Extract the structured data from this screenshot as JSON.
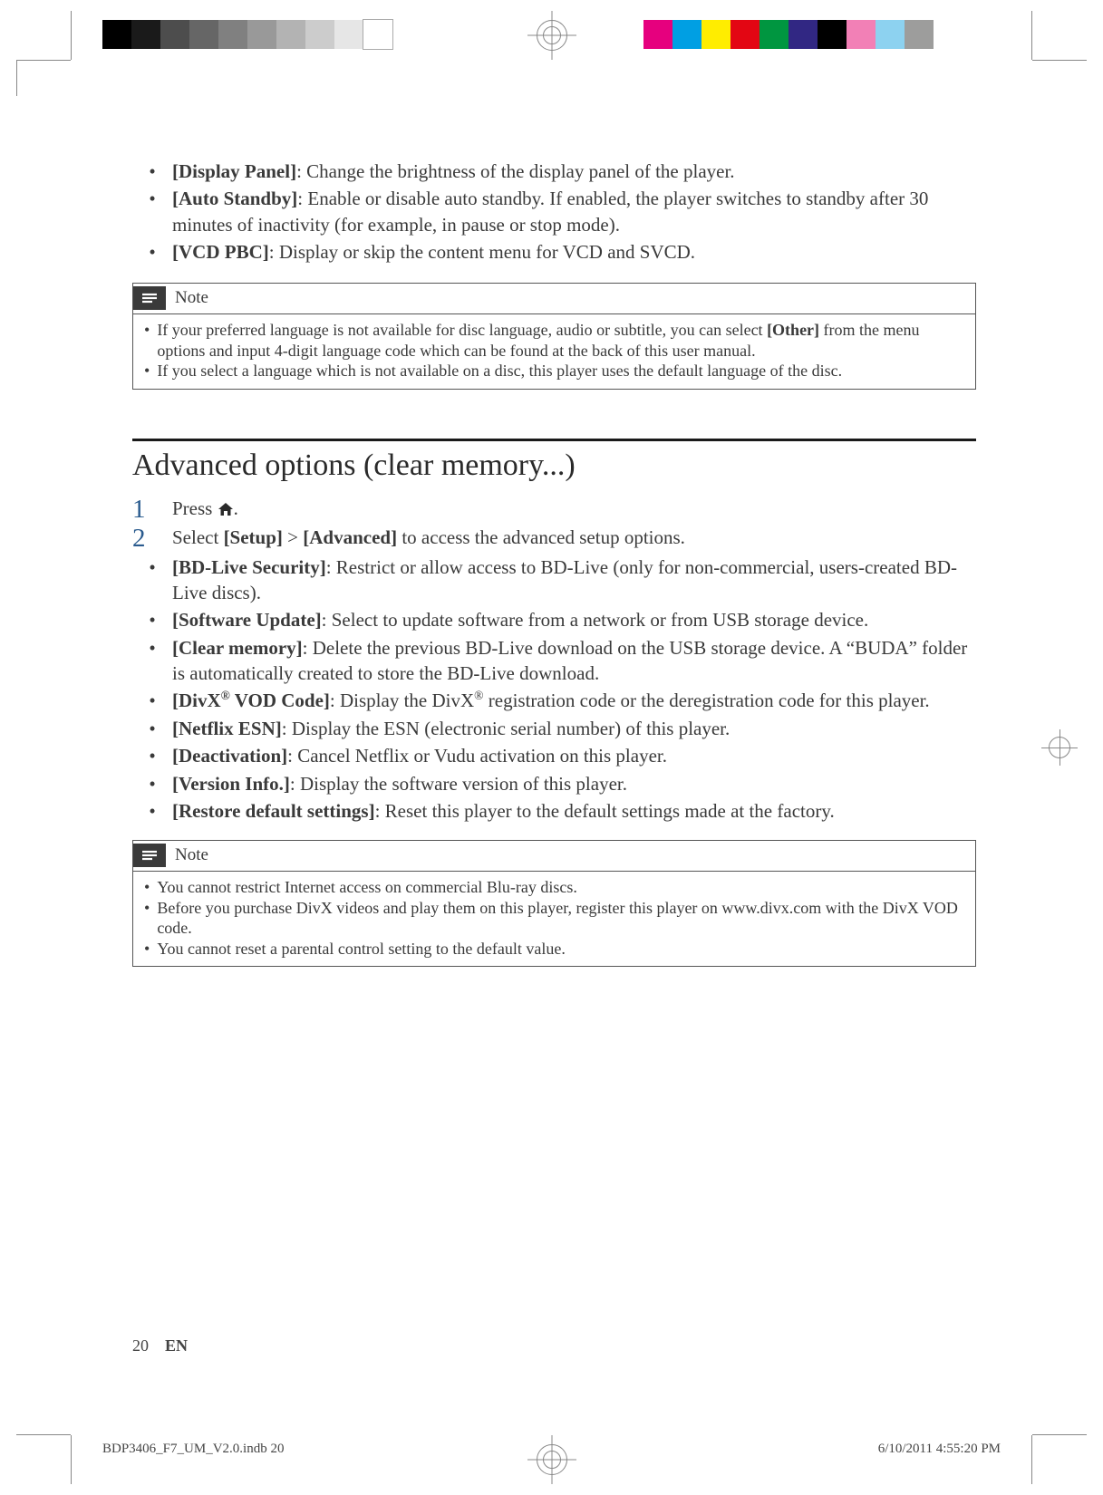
{
  "pref_section": {
    "items": [
      {
        "label": "[Display Panel]",
        "desc": ": Change the brightness of the display panel of the player."
      },
      {
        "label": "[Auto Standby]",
        "desc": ": Enable or disable auto standby. If enabled, the player switches to standby after 30 minutes of inactivity (for example, in pause or stop mode)."
      },
      {
        "label": "[VCD PBC]",
        "desc": ": Display or skip the content menu for VCD and SVCD."
      }
    ],
    "note_title": "Note",
    "note_items": [
      {
        "pre": "If your preferred language is not available for disc language, audio or subtitle, you can select ",
        "bold": "[Other]",
        "post": " from the menu options and input 4-digit language code which can be found at the back of this user manual."
      },
      {
        "text": "If you select a language which is not available on a disc, this player uses the default language of the disc."
      }
    ]
  },
  "advanced_section": {
    "title": "Advanced options (clear memory...)",
    "steps": [
      {
        "num": "1",
        "pre": "Press ",
        "icon": "home",
        "post": "."
      },
      {
        "num": "2",
        "pre": "Select ",
        "b1": "[Setup]",
        "mid": " > ",
        "b2": "[Advanced]",
        "post": " to access the advanced setup options."
      }
    ],
    "items": [
      {
        "label": "[BD-Live Security]",
        "desc": ": Restrict or allow access to BD-Live (only for non-commercial, users-created BD-Live discs)."
      },
      {
        "label": "[Software Update]",
        "desc": ": Select to update software from a network or from USB storage device."
      },
      {
        "label": "[Clear memory]",
        "desc": ": Delete the previous BD-Live download on the USB storage device. A “BUDA” folder is automatically created to store the BD-Live download."
      },
      {
        "label_html": "[DivX<sup>®</sup> VOD Code]",
        "desc_html": ": Display the DivX<sup>®</sup> registration code or the deregistration code for this player."
      },
      {
        "label": "[Netflix ESN]",
        "desc": ": Display the ESN (electronic serial number) of this player."
      },
      {
        "label": "[Deactivation]",
        "desc": ": Cancel Netflix or Vudu activation on this player."
      },
      {
        "label": "[Version Info.]",
        "desc": ": Display the software version of this player."
      },
      {
        "label": "[Restore default settings]",
        "desc": ": Reset this player to the default settings made at the factory."
      }
    ],
    "note_title": "Note",
    "note_items": [
      "You cannot restrict Internet access on commercial Blu-ray discs.",
      "Before you purchase DivX videos and play them on this player, register this player on www.divx.com with the DivX VOD code.",
      "You cannot reset a parental control setting to the default value."
    ]
  },
  "page": {
    "number": "20",
    "lang": "EN",
    "footer_left": "BDP3406_F7_UM_V2.0.indb   20",
    "footer_right": "6/10/2011   4:55:20 PM"
  },
  "colorbars": {
    "left": [
      "#000000",
      "#1a1a1a",
      "#4d4d4d",
      "#666666",
      "#808080",
      "#999999",
      "#b3b3b3",
      "#cccccc",
      "#e6e6e6",
      "#ffffff"
    ],
    "right": [
      "#e6007e",
      "#009fe3",
      "#ffed00",
      "#e30613",
      "#009640",
      "#312783",
      "#000000",
      "#f280b6",
      "#8dd2f0",
      "#9d9d9c"
    ]
  }
}
